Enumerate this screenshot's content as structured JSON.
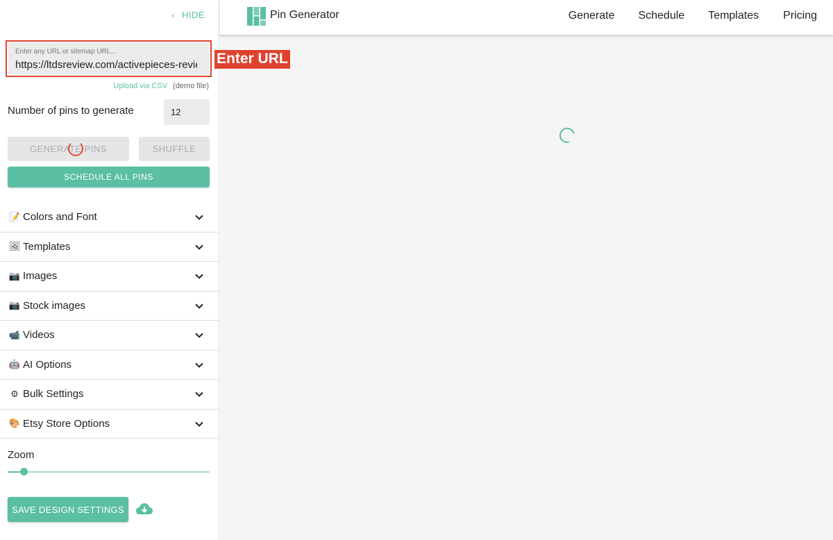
{
  "sidebar": {
    "hide_label": "HIDE",
    "url_field": {
      "placeholder": "Enter any URL or sitemap URL...",
      "value": "https://ltdsreview.com/activepieces-review/"
    },
    "upload_csv": "Upload via CSV",
    "demo_file": "(demo file)",
    "pins_label": "Number of pins to generate",
    "pins_value": "12",
    "generate_label": "GENERATE PINS",
    "shuffle_label": "SHUFFLE",
    "schedule_all_label": "SCHEDULE ALL PINS",
    "accordion": [
      {
        "icon": "memo-emoji",
        "emoji": "📝",
        "label": "Colors and Font"
      },
      {
        "icon": "framed-picture-emoji",
        "emoji": "🖼",
        "label": "Templates"
      },
      {
        "icon": "camera-emoji",
        "emoji": "📷",
        "label": "Images"
      },
      {
        "icon": "camera-emoji",
        "emoji": "📷",
        "label": "Stock images"
      },
      {
        "icon": "video-camera-emoji",
        "emoji": "📹",
        "label": "Videos"
      },
      {
        "icon": "robot-emoji",
        "emoji": "🤖",
        "label": "AI Options"
      },
      {
        "icon": "gear-emoji",
        "emoji": "⚙",
        "label": "Bulk Settings"
      },
      {
        "icon": "palette-emoji",
        "emoji": "🎨",
        "label": "Etsy Store Options"
      }
    ],
    "zoom_label": "Zoom",
    "zoom_value": 0.08,
    "save_label": "SAVE DESIGN SETTINGS"
  },
  "callout_label": "Enter URL",
  "header": {
    "brand": "Pin Generator",
    "nav": [
      "Generate",
      "Schedule",
      "Templates",
      "Pricing"
    ]
  },
  "colors": {
    "accent": "#5bbfa3",
    "callout": "#e0412d"
  }
}
